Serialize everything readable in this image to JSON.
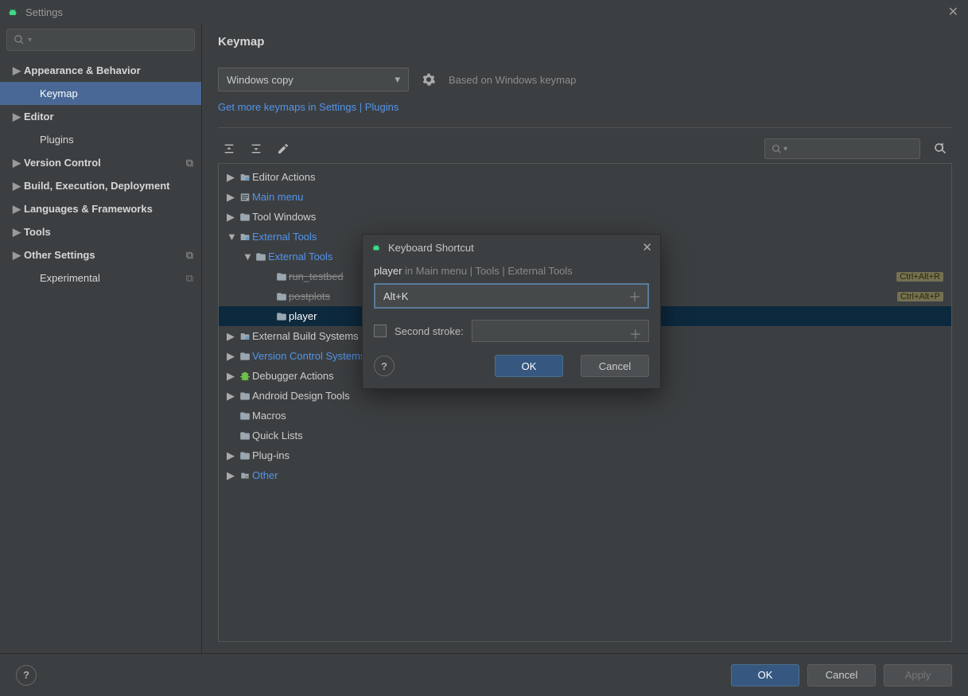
{
  "window_title": "Settings",
  "sidebar": {
    "items": [
      {
        "label": "Appearance & Behavior",
        "expand": true
      },
      {
        "label": "Keymap",
        "sub": true,
        "selected": true
      },
      {
        "label": "Editor",
        "expand": true
      },
      {
        "label": "Plugins",
        "sub": true
      },
      {
        "label": "Version Control",
        "expand": true,
        "pin": true
      },
      {
        "label": "Build, Execution, Deployment",
        "expand": true
      },
      {
        "label": "Languages & Frameworks",
        "expand": true
      },
      {
        "label": "Tools",
        "expand": true
      },
      {
        "label": "Other Settings",
        "expand": true,
        "pin": true
      },
      {
        "label": "Experimental",
        "sub": true,
        "pin": true
      }
    ]
  },
  "page": {
    "title": "Keymap",
    "keymap_selected": "Windows copy",
    "based_on": "Based on Windows keymap",
    "link_part1": "Get more keymaps in Settings | ",
    "link_part2": "Plugins"
  },
  "tree": [
    {
      "label": "Editor Actions",
      "cls": "lvl0",
      "icon": "gear",
      "expand": true
    },
    {
      "label": "Main menu",
      "cls": "lvl0",
      "icon": "menu",
      "link": true,
      "expand": true
    },
    {
      "label": "Tool Windows",
      "cls": "lvl0",
      "icon": "folder",
      "expand": true
    },
    {
      "label": "External Tools",
      "cls": "lvl0",
      "icon": "gear",
      "link": true,
      "open": true
    },
    {
      "label": "External Tools",
      "cls": "lvl1",
      "icon": "folder",
      "link": true,
      "open": true
    },
    {
      "label": "run_testbed",
      "cls": "lvl2",
      "icon": "folder",
      "strike": true,
      "sc": "Ctrl+Alt+R"
    },
    {
      "label": "postplots",
      "cls": "lvl2",
      "icon": "folder",
      "strike": true,
      "sc": "Ctrl+Alt+P"
    },
    {
      "label": "player",
      "cls": "lvl2",
      "icon": "folder",
      "selected": true
    },
    {
      "label": "External Build Systems",
      "cls": "lvl0",
      "icon": "gear",
      "expand": true
    },
    {
      "label": "Version Control Systems",
      "cls": "lvl0",
      "icon": "folder",
      "link": true,
      "expand": true
    },
    {
      "label": "Debugger Actions",
      "cls": "lvl0",
      "icon": "bug",
      "expand": true
    },
    {
      "label": "Android Design Tools",
      "cls": "lvl0",
      "icon": "folder",
      "expand": true
    },
    {
      "label": "Macros",
      "cls": "lvl0",
      "icon": "folder"
    },
    {
      "label": "Quick Lists",
      "cls": "lvl0",
      "icon": "folder"
    },
    {
      "label": "Plug-ins",
      "cls": "lvl0",
      "icon": "folder",
      "expand": true
    },
    {
      "label": "Other",
      "cls": "lvl0",
      "icon": "other",
      "link": true,
      "expand": true
    }
  ],
  "modal": {
    "title": "Keyboard Shortcut",
    "crumb_bold": "player",
    "crumb_rest": " in Main menu | Tools | External Tools",
    "shortcut": "Alt+K",
    "second_label": "Second stroke:",
    "ok": "OK",
    "cancel": "Cancel"
  },
  "footer": {
    "ok": "OK",
    "cancel": "Cancel",
    "apply": "Apply"
  }
}
